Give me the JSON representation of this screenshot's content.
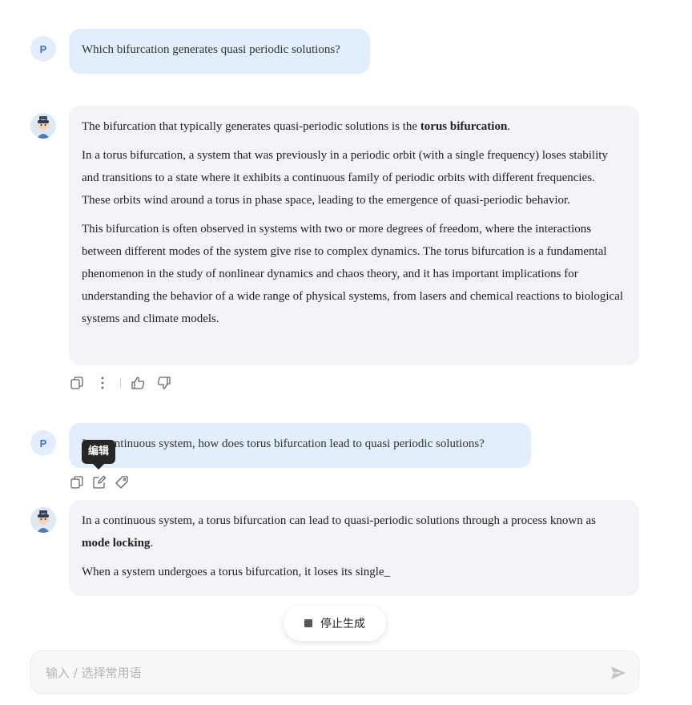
{
  "conversation": {
    "msg1": {
      "avatar_letter": "P",
      "text": "Which bifurcation generates quasi periodic solutions?"
    },
    "msg2": {
      "p1_before": "The bifurcation that typically generates quasi-periodic solutions is the ",
      "p1_bold": "torus bifurcation",
      "p1_after": ".",
      "p2": "In a torus bifurcation, a system that was previously in a periodic orbit (with a single frequency) loses stability and transitions to a state where it exhibits a continuous family of periodic orbits with different frequencies. These orbits wind around a torus in phase space, leading to the emergence of quasi-periodic behavior.",
      "p3": "This bifurcation is often observed in systems with two or more degrees of freedom, where the interactions between different modes of the system give rise to complex dynamics. The torus bifurcation is a fundamental phenomenon in the study of nonlinear dynamics and chaos theory, and it has important implications for understanding the behavior of a wide range of physical systems, from lasers and chemical reactions to biological systems and climate models."
    },
    "msg3": {
      "avatar_letter": "P",
      "text": "In a continuous system, how does torus bifurcation lead to quasi periodic solutions?",
      "tooltip": "编辑"
    },
    "msg4": {
      "p1_before": "In a continuous system, a torus bifurcation can lead to quasi-periodic solutions through a process known as ",
      "p1_bold": "mode locking",
      "p1_after": ".",
      "p2": "When a system undergoes a torus bifurcation, it loses its single_"
    }
  },
  "actions": {
    "bot_actions": [
      "copy-icon",
      "more-icon",
      "thumbs-up-icon",
      "thumbs-down-icon"
    ],
    "user_actions": [
      "copy-icon",
      "edit-icon",
      "tag-icon"
    ]
  },
  "stop_button": {
    "label": "停止生成"
  },
  "input": {
    "placeholder": "输入 / 选择常用语",
    "value": ""
  },
  "colors": {
    "user_bubble": "#e2eefd",
    "bot_bubble": "#f3f4f7",
    "accent": "#3b6fd6"
  }
}
